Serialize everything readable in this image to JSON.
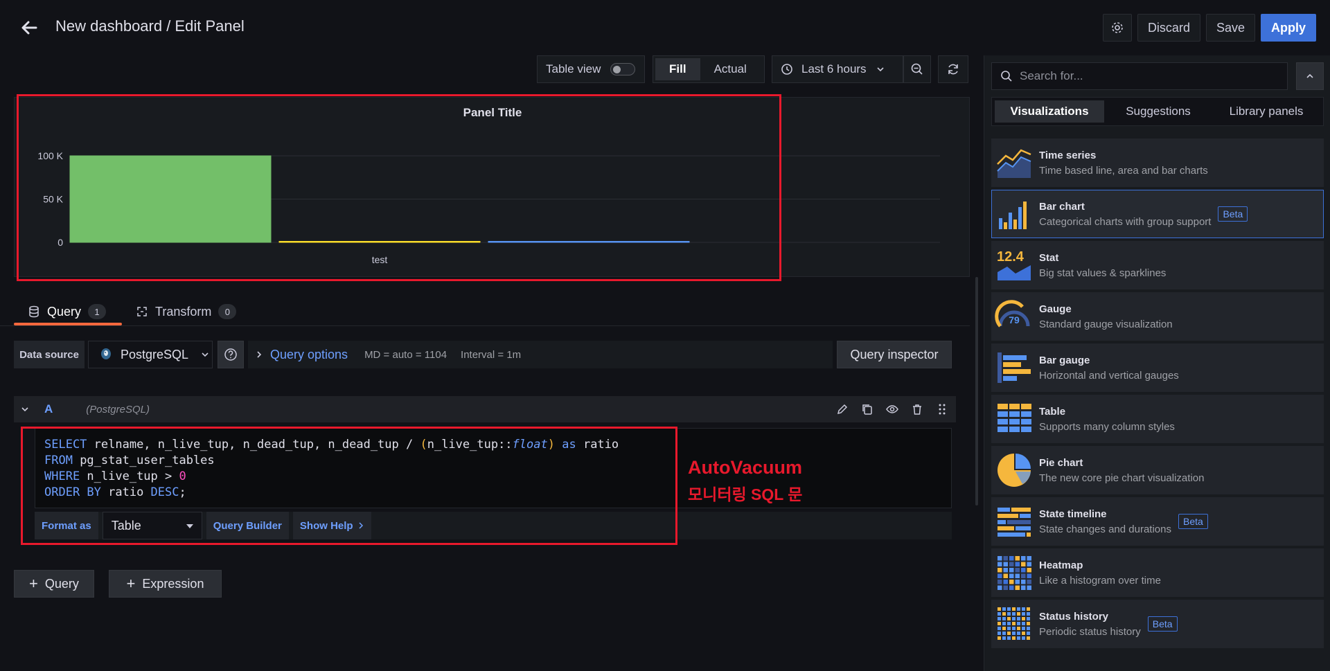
{
  "header": {
    "title": "New dashboard / Edit Panel",
    "discard": "Discard",
    "save": "Save",
    "apply": "Apply"
  },
  "panel_toolbar": {
    "table_view": "Table view",
    "fill": "Fill",
    "actual": "Actual",
    "time_range": "Last 6 hours"
  },
  "panel": {
    "title": "Panel Title"
  },
  "chart_data": {
    "type": "bar",
    "title": "Panel Title",
    "categories": [
      "test"
    ],
    "series": [
      {
        "name": "",
        "values": [
          100000
        ],
        "color": "#73bf69"
      },
      {
        "name": "",
        "values": [
          0
        ],
        "color": "#fade2a"
      },
      {
        "name": "",
        "values": [
          0
        ],
        "color": "#5794f2"
      }
    ],
    "y_ticks": [
      "100 K",
      "50 K",
      "0"
    ],
    "ylim": [
      0,
      100000
    ],
    "grid": true
  },
  "tabs": {
    "query": "Query",
    "query_count": "1",
    "transform": "Transform",
    "transform_count": "0"
  },
  "datasource": {
    "label": "Data source",
    "name": "PostgreSQL",
    "query_options": "Query options",
    "md": "MD = auto = 1104",
    "interval": "Interval = 1m",
    "inspector": "Query inspector"
  },
  "query_row": {
    "letter": "A",
    "datasource": "(PostgreSQL)",
    "sql_lines": [
      "SELECT relname, n_live_tup, n_dead_tup, n_dead_tup / (n_live_tup::float) as ratio",
      "FROM pg_stat_user_tables",
      "WHERE n_live_tup > 0",
      "ORDER BY ratio DESC;"
    ],
    "format_as_label": "Format as",
    "format_value": "Table",
    "query_builder": "Query Builder",
    "show_help": "Show Help"
  },
  "annotation": {
    "line1": "AutoVacuum",
    "line2": "모니터링 SQL 문",
    "color": "#e8192c"
  },
  "add": {
    "query": "Query",
    "expression": "Expression"
  },
  "sidebar": {
    "search_placeholder": "Search for...",
    "tabs": [
      "Visualizations",
      "Suggestions",
      "Library panels"
    ],
    "items": [
      {
        "name": "Time series",
        "desc": "Time based line, area and bar charts",
        "icon": "time-series-icon",
        "beta": ""
      },
      {
        "name": "Bar chart",
        "desc": "Categorical charts with group support",
        "icon": "bar-chart-icon",
        "beta": "Beta"
      },
      {
        "name": "Stat",
        "desc": "Big stat values & sparklines",
        "icon": "stat-icon",
        "beta": "",
        "icon_text": "12.4"
      },
      {
        "name": "Gauge",
        "desc": "Standard gauge visualization",
        "icon": "gauge-icon",
        "beta": "",
        "icon_text": "79"
      },
      {
        "name": "Bar gauge",
        "desc": "Horizontal and vertical gauges",
        "icon": "bar-gauge-icon",
        "beta": ""
      },
      {
        "name": "Table",
        "desc": "Supports many column styles",
        "icon": "table-icon",
        "beta": ""
      },
      {
        "name": "Pie chart",
        "desc": "The new core pie chart visualization",
        "icon": "pie-chart-icon",
        "beta": ""
      },
      {
        "name": "State timeline",
        "desc": "State changes and durations",
        "icon": "state-timeline-icon",
        "beta": "Beta"
      },
      {
        "name": "Heatmap",
        "desc": "Like a histogram over time",
        "icon": "heatmap-icon",
        "beta": ""
      },
      {
        "name": "Status history",
        "desc": "Periodic status history",
        "icon": "status-history-icon",
        "beta": "Beta"
      }
    ]
  }
}
